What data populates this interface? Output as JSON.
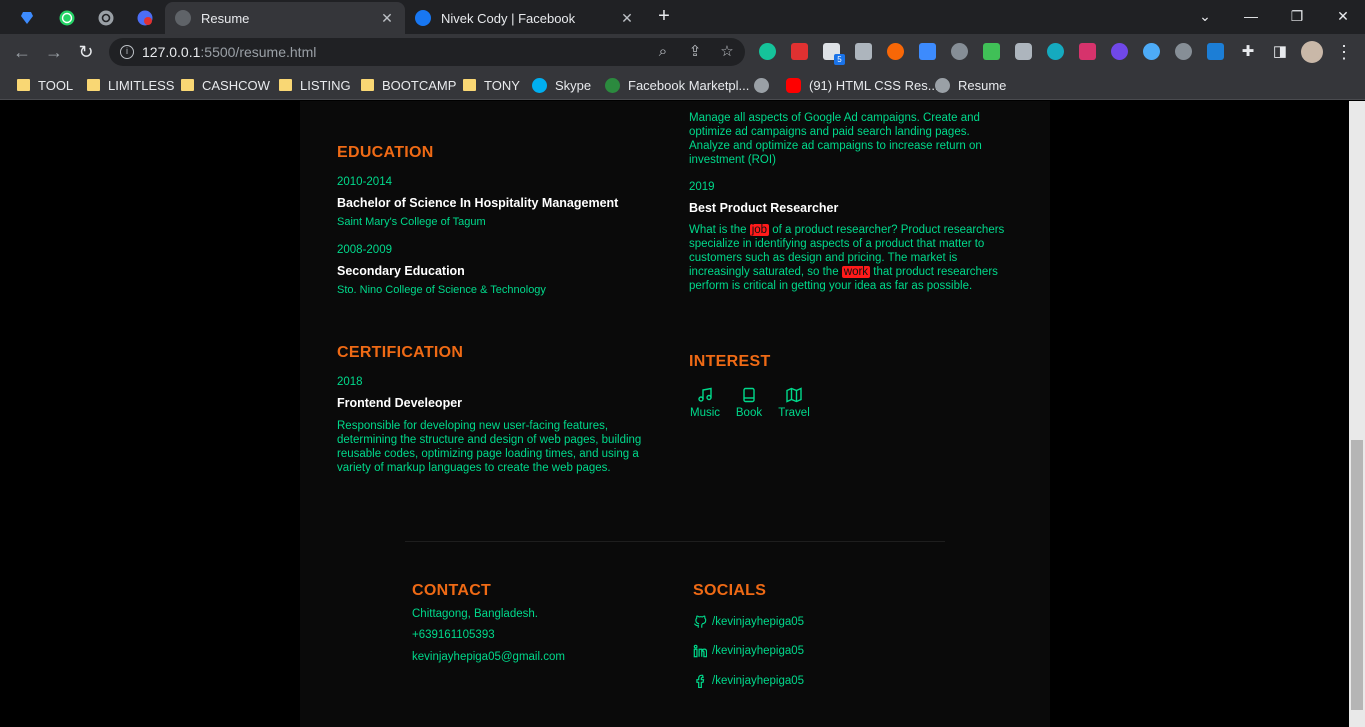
{
  "browser": {
    "tabs": [
      {
        "title": "Resume",
        "active": true
      },
      {
        "title": "Nivek Cody | Facebook",
        "active": false
      }
    ],
    "new_tab": "+",
    "url": {
      "host": "127.0.0.1",
      "rest": ":5500/resume.html"
    },
    "bookmarks": [
      "TOOL",
      "LIMITLESS",
      "CASHCOW",
      "LISTING",
      "BOOTCAMP",
      "TONY",
      "Skype",
      "Facebook Marketpl...",
      "(91) HTML CSS Res...",
      "Resume"
    ],
    "extension_badge": "5"
  },
  "colors": {
    "accent_orange": "#ef6a15",
    "accent_green": "#00d98b",
    "highlight_red": "#ff1a1a"
  },
  "experience_tail": {
    "desc1": "Manage all aspects of Google Ad campaigns. Create and optimize ad campaigns and paid search landing pages. Analyze and optimize ad campaigns to increase return on investment (ROI)",
    "year2": "2019",
    "title2": "Best Product Researcher",
    "desc2_a": "What is the ",
    "desc2_hl1": "job",
    "desc2_b": " of a product researcher? Product researchers specialize in identifying aspects of a product that matter to customers such as design and pricing. The market is increasingly saturated, so the ",
    "desc2_hl2": "work",
    "desc2_c": " that product researchers perform is critical in getting your idea as far as possible."
  },
  "education": {
    "title": "EDUCATION",
    "items": [
      {
        "years": "2010-2014",
        "degree": "Bachelor of Science In Hospitality Management",
        "school": "Saint Mary's College of Tagum"
      },
      {
        "years": "2008-2009",
        "degree": "Secondary Education",
        "school": "Sto. Nino College of Science & Technology"
      }
    ]
  },
  "certification": {
    "title": "CERTIFICATION",
    "year": "2018",
    "name": "Frontend Develeoper",
    "desc": "Responsible for developing new user-facing features, determining the structure and design of web pages, building reusable codes, optimizing page loading times, and using a variety of markup languages to create the web pages."
  },
  "interest": {
    "title": "INTEREST",
    "items": [
      {
        "label": "Music",
        "icon": "music-icon"
      },
      {
        "label": "Book",
        "icon": "book-icon"
      },
      {
        "label": "Travel",
        "icon": "map-icon"
      }
    ]
  },
  "contact": {
    "title": "CONTACT",
    "address": "Chittagong, Bangladesh.",
    "phone": "+639161105393",
    "email": "kevinjayhepiga05@gmail.com"
  },
  "socials": {
    "title": "SOCIALS",
    "items": [
      {
        "handle": "/kevinjayhepiga05",
        "icon": "github-icon"
      },
      {
        "handle": "/kevinjayhepiga05",
        "icon": "linkedin-icon"
      },
      {
        "handle": "/kevinjayhepiga05",
        "icon": "facebook-icon"
      }
    ]
  }
}
